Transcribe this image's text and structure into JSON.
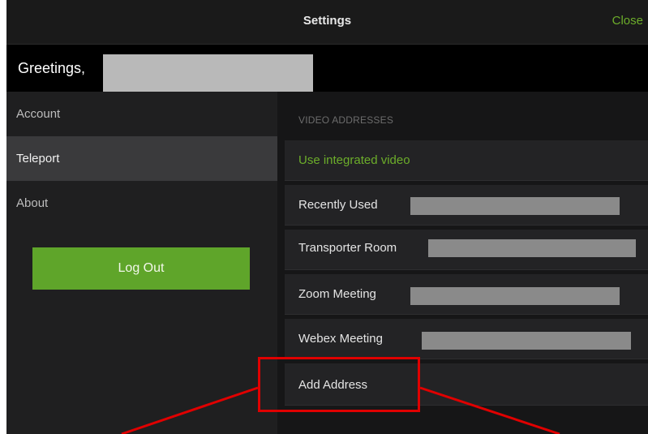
{
  "header": {
    "title": "Settings",
    "close_label": "Close"
  },
  "greeting": {
    "text": "Greetings,"
  },
  "sidebar": {
    "items": [
      {
        "label": "Account"
      },
      {
        "label": "Teleport"
      },
      {
        "label": "About"
      }
    ],
    "logout_label": "Log Out"
  },
  "main": {
    "section_title": "VIDEO ADDRESSES",
    "rows": [
      {
        "label": "Use integrated video"
      },
      {
        "label": "Recently Used"
      },
      {
        "label": "Transporter Room"
      },
      {
        "label": "Zoom Meeting"
      },
      {
        "label": "Webex Meeting"
      },
      {
        "label": "Add Address"
      }
    ]
  },
  "colors": {
    "accent_green": "#6cad2a",
    "button_green": "#5fa52a",
    "annotation_red": "#e00000",
    "redaction_gray": "#8a8a8a"
  }
}
